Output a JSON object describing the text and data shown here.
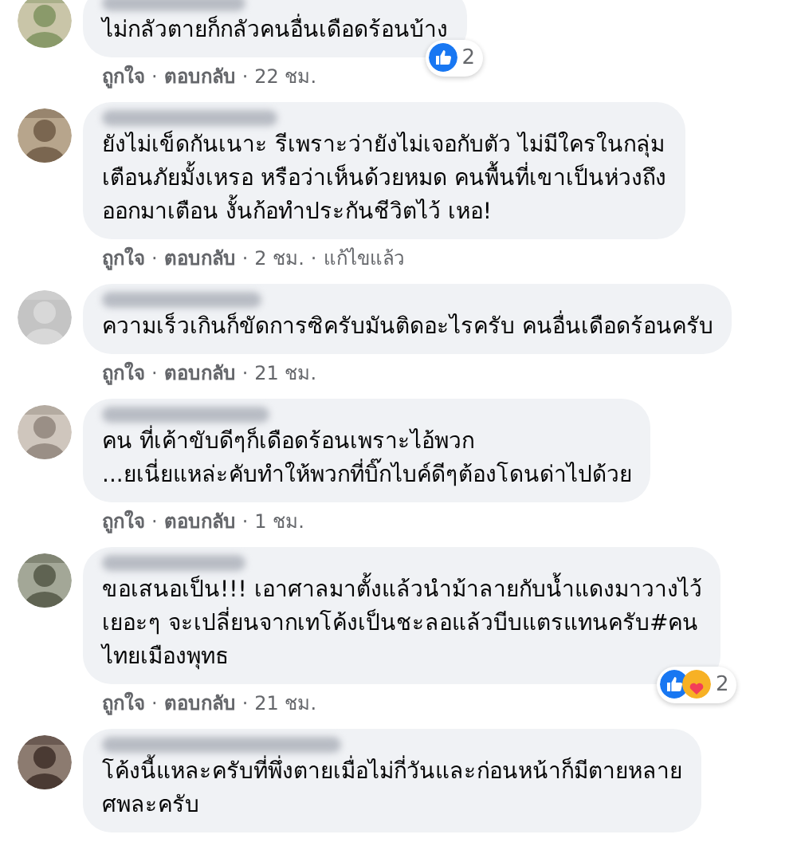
{
  "meta_separator": "·",
  "comments": [
    {
      "text": "ไม่กลัวตายก็กลัวคนอื่นเดือดร้อนบ้าง",
      "meta": [
        {
          "kind": "link",
          "label": "ถูกใจ"
        },
        {
          "kind": "link",
          "label": "ตอบกลับ"
        },
        {
          "kind": "time",
          "label": "22 ชม."
        }
      ],
      "reactions": {
        "icons": [
          {
            "kind": "like"
          }
        ],
        "count": "2"
      }
    },
    {
      "text": "ยังไม่เข็ดกันเนาะ รีเพราะว่ายังไม่เจอกับตัว ไม่มีใครในกลุ่ม\nเตือนภัยมั้งเหรอ หรือว่าเห็นด้วยหมด คนพื้นที่เขาเป็นห่วงถึง\nออกมาเตือน งั้นก้อทำประกันชีวิตไว้ เหอ!",
      "meta": [
        {
          "kind": "link",
          "label": "ถูกใจ"
        },
        {
          "kind": "link",
          "label": "ตอบกลับ"
        },
        {
          "kind": "time",
          "label": "2 ชม."
        },
        {
          "kind": "note",
          "label": "แก้ไขแล้ว"
        }
      ]
    },
    {
      "text": "ความเร็วเกินก็ขัดการซิครับมันติดอะไรครับ คนอื่นเดือดร้อนครับ",
      "meta": [
        {
          "kind": "link",
          "label": "ถูกใจ"
        },
        {
          "kind": "link",
          "label": "ตอบกลับ"
        },
        {
          "kind": "time",
          "label": "21 ชม."
        }
      ]
    },
    {
      "text": "คน ที่เค้าขับดีๆก็เดือดร้อนเพราะไอ้พวก\n...ยเนี่ยแหล่ะคับทำให้พวกที่บิ๊กไบค์ดีๆต้องโดนด่าไปด้วย",
      "meta": [
        {
          "kind": "link",
          "label": "ถูกใจ"
        },
        {
          "kind": "link",
          "label": "ตอบกลับ"
        },
        {
          "kind": "time",
          "label": "1 ชม."
        }
      ]
    },
    {
      "text": "ขอเสนอเป็น!!! เอาศาลมาตั้งแล้วนำม้าลายกับน้ำแดงมาวางไว้\nเยอะๆ จะเปลี่ยนจากเทโค้งเป็นชะลอแล้วบีบแตรแทนครับ#คน\nไทยเมืองพุทธ",
      "meta": [
        {
          "kind": "link",
          "label": "ถูกใจ"
        },
        {
          "kind": "link",
          "label": "ตอบกลับ"
        },
        {
          "kind": "time",
          "label": "21 ชม."
        }
      ],
      "reactions": {
        "icons": [
          {
            "kind": "like"
          },
          {
            "kind": "care"
          }
        ],
        "count": "2"
      }
    },
    {
      "text": "โค้งนี้แหละครับที่พึ่งตายเมื่อไม่กี่วันและก่อนหน้าก็มีตายหลาย\nศพละครับ"
    }
  ]
}
